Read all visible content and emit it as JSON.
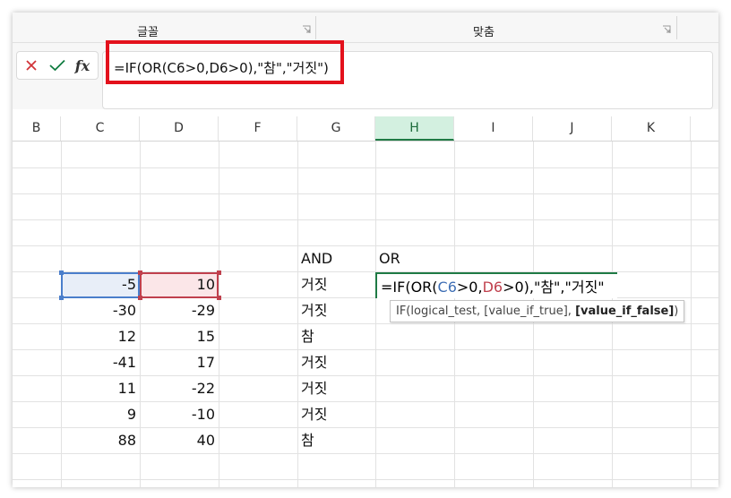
{
  "ribbon": {
    "groups": [
      {
        "label": "글꼴"
      },
      {
        "label": "맞춤"
      }
    ]
  },
  "formula_bar": {
    "cancel_icon": "x-icon",
    "enter_icon": "check-icon",
    "fx_label": "fx",
    "formula": "=IF(OR(C6>0,D6>0),\"참\",\"거짓\")",
    "highlight_color": "#e3111c"
  },
  "columns": {
    "headers": [
      "B",
      "C",
      "D",
      "F",
      "G",
      "H",
      "I",
      "J",
      "K"
    ],
    "active": "H"
  },
  "cells": {
    "G5": "AND",
    "H5": "OR",
    "rows": [
      {
        "C": "-5",
        "D": "10",
        "G": "거짓"
      },
      {
        "C": "-30",
        "D": "-29",
        "G": "거짓"
      },
      {
        "C": "12",
        "D": "15",
        "G": "참"
      },
      {
        "C": "-41",
        "D": "17",
        "G": "거짓"
      },
      {
        "C": "11",
        "D": "-22",
        "G": "거짓"
      },
      {
        "C": "9",
        "D": "-10",
        "G": "거짓"
      },
      {
        "C": "88",
        "D": "40",
        "G": "참"
      }
    ]
  },
  "edit_cell": {
    "prefix": "=IF(OR(",
    "ref1": "C6",
    "mid1": ">0,",
    "ref2": "D6",
    "mid2": ">0)",
    "suffix": ",\"참\",\"거짓\"",
    "ref1_color": "#3f6fb5",
    "ref2_color": "#c0404d"
  },
  "tooltip": {
    "head": "IF(logical_test, [value_if_true], ",
    "bold_arg": "[value_if_false]",
    "tail": ")"
  },
  "colors": {
    "active_header_bg": "#d3f0e0",
    "active_header_fg": "#1d6b3b",
    "sel_c6_border": "#4a7ecb",
    "sel_d6_border": "#c0404d"
  }
}
